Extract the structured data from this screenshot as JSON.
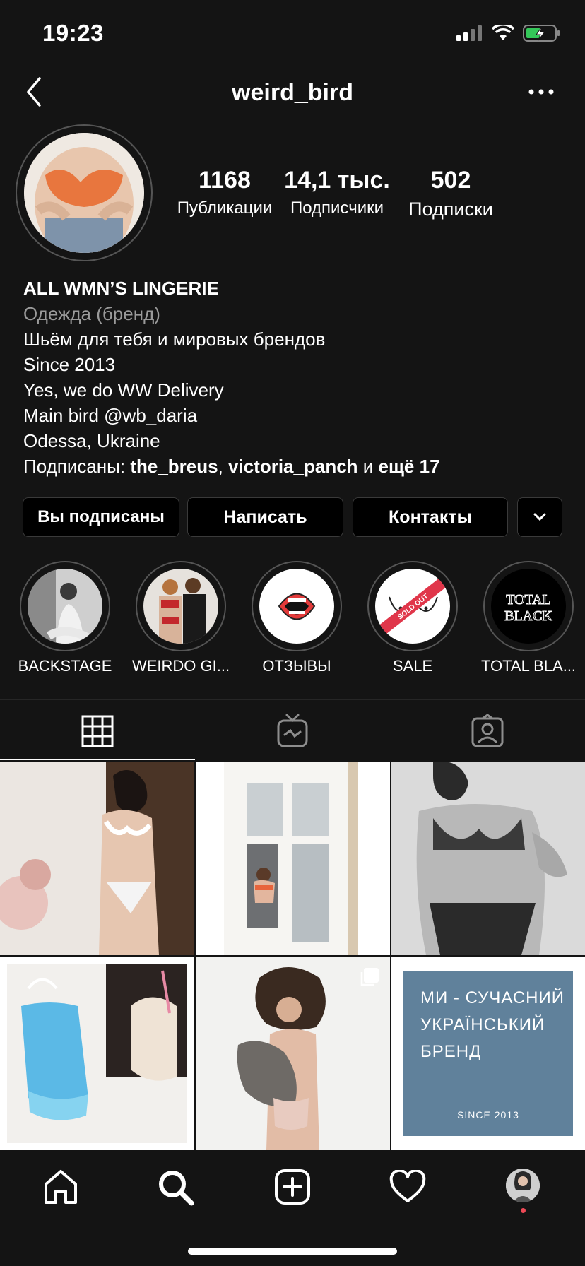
{
  "status": {
    "time": "19:23"
  },
  "header": {
    "username": "weird_bird"
  },
  "stats": [
    {
      "value": "1168",
      "label": "Публикации"
    },
    {
      "value": "14,1 тыс.",
      "label": "Подписчики"
    },
    {
      "value": "502",
      "label": "Подписки"
    }
  ],
  "bio": {
    "name": "ALL WMN’S LINGERIE",
    "category": "Одежда (бренд)",
    "lines": [
      "Шьём для тебя и мировых брендов",
      "Since 2013",
      "Yes, we do WW Delivery",
      "Main bird @wb_daria",
      "Odessa, Ukraine"
    ],
    "followed_prefix": "Подписаны: ",
    "followed_user1": "the_breus",
    "followed_sep": ", ",
    "followed_user2": "victoria_panch",
    "followed_and": " и ",
    "followed_more": "ещё 17"
  },
  "buttons": {
    "following": "Вы подписаны",
    "message": "Написать",
    "contacts": "Контакты"
  },
  "highlights": [
    {
      "label": "BACKSTAGE"
    },
    {
      "label": "WEIRDO GI..."
    },
    {
      "label": "ОТЗЫВЫ"
    },
    {
      "label": "SALE",
      "sticker_text": "SOLD OUT"
    },
    {
      "label": "TOTAL BLA...",
      "cover_text_1": "TOTAL",
      "cover_text_2": "BLACK"
    }
  ],
  "grid_tile6": {
    "line1": "МИ - СУЧАСНИЙ",
    "line2": "УКРАЇНСЬКИЙ",
    "line3": "БРЕНД",
    "footer": "SINCE 2013",
    "bg_color": "#60819b"
  },
  "colors": {
    "notification_dot": "#ed4956"
  }
}
